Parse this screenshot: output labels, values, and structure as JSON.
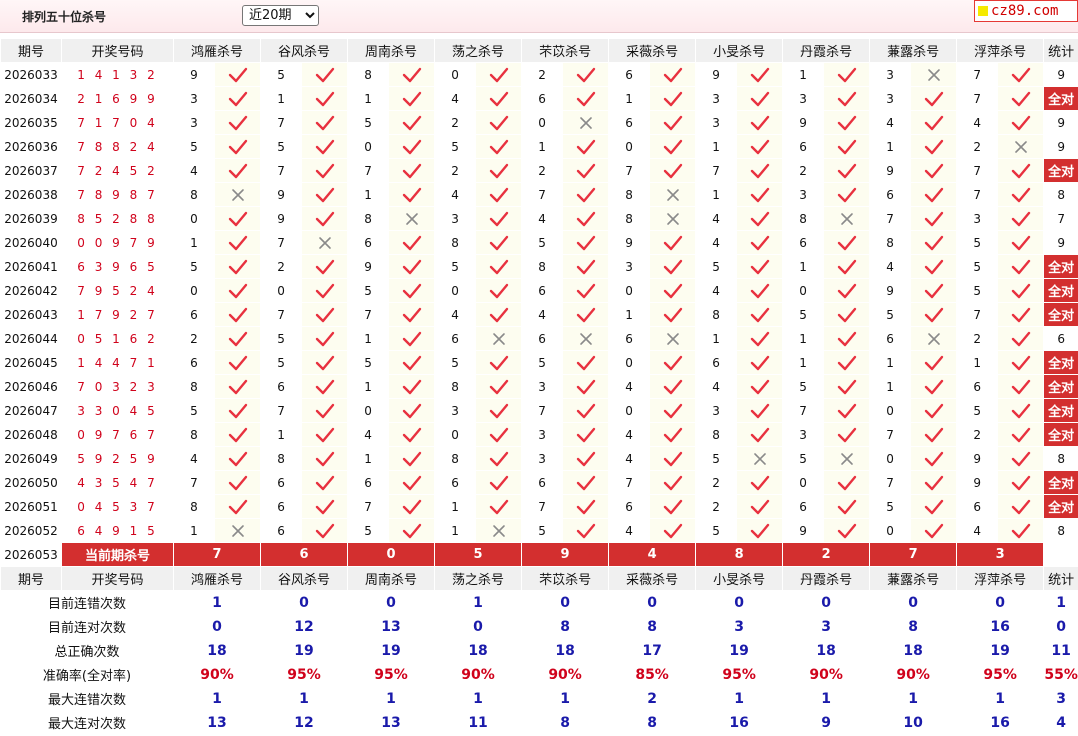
{
  "header": {
    "title": "排列五十位杀号",
    "period_options": [
      "近20期"
    ],
    "period_selected": "近20期",
    "logo_text": "cz89.com"
  },
  "columns": {
    "issue": "期号",
    "draw": "开奖号码",
    "experts": [
      "鸿雁杀号",
      "谷风杀号",
      "周南杀号",
      "荡之杀号",
      "芣苡杀号",
      "采薇杀号",
      "小旻杀号",
      "丹霞杀号",
      "蒹露杀号",
      "浮萍杀号"
    ],
    "stats": "统计"
  },
  "all_correct_label": "全对",
  "rows": [
    {
      "issue": "2026033",
      "draw": "14132",
      "kills": [
        "9",
        "5",
        "8",
        "0",
        "2",
        "6",
        "9",
        "1",
        "3",
        "7"
      ],
      "hit": [
        1,
        1,
        1,
        1,
        1,
        1,
        1,
        1,
        0,
        1
      ],
      "count": "9"
    },
    {
      "issue": "2026034",
      "draw": "21699",
      "kills": [
        "3",
        "1",
        "1",
        "4",
        "6",
        "1",
        "3",
        "3",
        "3",
        "7"
      ],
      "hit": [
        1,
        1,
        1,
        1,
        1,
        1,
        1,
        1,
        1,
        1
      ],
      "count": "全对"
    },
    {
      "issue": "2026035",
      "draw": "71704",
      "kills": [
        "3",
        "7",
        "5",
        "2",
        "0",
        "6",
        "3",
        "9",
        "4",
        "4"
      ],
      "hit": [
        1,
        1,
        1,
        1,
        0,
        1,
        1,
        1,
        1,
        1
      ],
      "count": "9"
    },
    {
      "issue": "2026036",
      "draw": "78824",
      "kills": [
        "5",
        "5",
        "0",
        "5",
        "1",
        "0",
        "1",
        "6",
        "1",
        "2"
      ],
      "hit": [
        1,
        1,
        1,
        1,
        1,
        1,
        1,
        1,
        1,
        0
      ],
      "count": "9"
    },
    {
      "issue": "2026037",
      "draw": "72452",
      "kills": [
        "4",
        "7",
        "7",
        "2",
        "2",
        "7",
        "7",
        "2",
        "9",
        "7"
      ],
      "hit": [
        1,
        1,
        1,
        1,
        1,
        1,
        1,
        1,
        1,
        1
      ],
      "count": "全对"
    },
    {
      "issue": "2026038",
      "draw": "78987",
      "kills": [
        "8",
        "9",
        "1",
        "4",
        "7",
        "8",
        "1",
        "3",
        "6",
        "7"
      ],
      "hit": [
        0,
        1,
        1,
        1,
        1,
        0,
        1,
        1,
        1,
        1
      ],
      "count": "8"
    },
    {
      "issue": "2026039",
      "draw": "85288",
      "kills": [
        "0",
        "9",
        "8",
        "3",
        "4",
        "8",
        "4",
        "8",
        "7",
        "3"
      ],
      "hit": [
        1,
        1,
        0,
        1,
        1,
        0,
        1,
        0,
        1,
        1
      ],
      "count": "7"
    },
    {
      "issue": "2026040",
      "draw": "00979",
      "kills": [
        "1",
        "7",
        "6",
        "8",
        "5",
        "9",
        "4",
        "6",
        "8",
        "5"
      ],
      "hit": [
        1,
        0,
        1,
        1,
        1,
        1,
        1,
        1,
        1,
        1
      ],
      "count": "9"
    },
    {
      "issue": "2026041",
      "draw": "63965",
      "kills": [
        "5",
        "2",
        "9",
        "5",
        "8",
        "3",
        "5",
        "1",
        "4",
        "5"
      ],
      "hit": [
        1,
        1,
        1,
        1,
        1,
        1,
        1,
        1,
        1,
        1
      ],
      "count": "全对"
    },
    {
      "issue": "2026042",
      "draw": "79524",
      "kills": [
        "0",
        "0",
        "5",
        "0",
        "6",
        "0",
        "4",
        "0",
        "9",
        "5"
      ],
      "hit": [
        1,
        1,
        1,
        1,
        1,
        1,
        1,
        1,
        1,
        1
      ],
      "count": "全对"
    },
    {
      "issue": "2026043",
      "draw": "17927",
      "kills": [
        "6",
        "7",
        "7",
        "4",
        "4",
        "1",
        "8",
        "5",
        "5",
        "7"
      ],
      "hit": [
        1,
        1,
        1,
        1,
        1,
        1,
        1,
        1,
        1,
        1
      ],
      "count": "全对"
    },
    {
      "issue": "2026044",
      "draw": "05162",
      "kills": [
        "2",
        "5",
        "1",
        "6",
        "6",
        "6",
        "1",
        "1",
        "6",
        "2"
      ],
      "hit": [
        1,
        1,
        1,
        0,
        0,
        0,
        1,
        1,
        0,
        1
      ],
      "count": "6"
    },
    {
      "issue": "2026045",
      "draw": "14471",
      "kills": [
        "6",
        "5",
        "5",
        "5",
        "5",
        "0",
        "6",
        "1",
        "1",
        "1"
      ],
      "hit": [
        1,
        1,
        1,
        1,
        1,
        1,
        1,
        1,
        1,
        1
      ],
      "count": "全对"
    },
    {
      "issue": "2026046",
      "draw": "70323",
      "kills": [
        "8",
        "6",
        "1",
        "8",
        "3",
        "4",
        "4",
        "5",
        "1",
        "6"
      ],
      "hit": [
        1,
        1,
        1,
        1,
        1,
        1,
        1,
        1,
        1,
        1
      ],
      "count": "全对"
    },
    {
      "issue": "2026047",
      "draw": "33045",
      "kills": [
        "5",
        "7",
        "0",
        "3",
        "7",
        "0",
        "3",
        "7",
        "0",
        "5"
      ],
      "hit": [
        1,
        1,
        1,
        1,
        1,
        1,
        1,
        1,
        1,
        1
      ],
      "count": "全对"
    },
    {
      "issue": "2026048",
      "draw": "09767",
      "kills": [
        "8",
        "1",
        "4",
        "0",
        "3",
        "4",
        "8",
        "3",
        "7",
        "2"
      ],
      "hit": [
        1,
        1,
        1,
        1,
        1,
        1,
        1,
        1,
        1,
        1
      ],
      "count": "全对"
    },
    {
      "issue": "2026049",
      "draw": "59259",
      "kills": [
        "4",
        "8",
        "1",
        "8",
        "3",
        "4",
        "5",
        "5",
        "0",
        "9"
      ],
      "hit": [
        1,
        1,
        1,
        1,
        1,
        1,
        0,
        0,
        1,
        1
      ],
      "count": "8"
    },
    {
      "issue": "2026050",
      "draw": "43547",
      "kills": [
        "7",
        "6",
        "6",
        "6",
        "6",
        "7",
        "2",
        "0",
        "7",
        "9"
      ],
      "hit": [
        1,
        1,
        1,
        1,
        1,
        1,
        1,
        1,
        1,
        1
      ],
      "count": "全对"
    },
    {
      "issue": "2026051",
      "draw": "04537",
      "kills": [
        "8",
        "6",
        "7",
        "1",
        "7",
        "6",
        "2",
        "6",
        "5",
        "6"
      ],
      "hit": [
        1,
        1,
        1,
        1,
        1,
        1,
        1,
        1,
        1,
        1
      ],
      "count": "全对"
    },
    {
      "issue": "2026052",
      "draw": "64915",
      "kills": [
        "1",
        "6",
        "5",
        "1",
        "5",
        "4",
        "5",
        "9",
        "0",
        "4"
      ],
      "hit": [
        0,
        1,
        1,
        0,
        1,
        1,
        1,
        1,
        1,
        1
      ],
      "count": "8"
    }
  ],
  "current": {
    "issue": "2026053",
    "label": "当前期杀号",
    "kills": [
      "7",
      "6",
      "0",
      "5",
      "9",
      "4",
      "8",
      "2",
      "7",
      "3"
    ]
  },
  "stats": [
    {
      "label": "目前连错次数",
      "values": [
        "1",
        "0",
        "0",
        "1",
        "0",
        "0",
        "0",
        "0",
        "0",
        "0"
      ],
      "total": "1"
    },
    {
      "label": "目前连对次数",
      "values": [
        "0",
        "12",
        "13",
        "0",
        "8",
        "8",
        "3",
        "3",
        "8",
        "16"
      ],
      "total": "0"
    },
    {
      "label": "总正确次数",
      "values": [
        "18",
        "19",
        "19",
        "18",
        "18",
        "17",
        "19",
        "18",
        "18",
        "19"
      ],
      "total": "11"
    },
    {
      "label": "准确率(全对率)",
      "values": [
        "90%",
        "95%",
        "95%",
        "90%",
        "90%",
        "85%",
        "95%",
        "90%",
        "90%",
        "95%"
      ],
      "total": "55%"
    },
    {
      "label": "最大连错次数",
      "values": [
        "1",
        "1",
        "1",
        "1",
        "1",
        "2",
        "1",
        "1",
        "1",
        "1"
      ],
      "total": "3"
    },
    {
      "label": "最大连对次数",
      "values": [
        "13",
        "12",
        "13",
        "11",
        "8",
        "8",
        "16",
        "9",
        "10",
        "16"
      ],
      "total": "4"
    }
  ],
  "colors": {
    "accent_red": "#d32f2f",
    "check_red": "#e8313f",
    "cross_grey": "#8a8a8a",
    "stat_blue": "#1a1aaa",
    "row_yellow": "#fdfdf0"
  }
}
